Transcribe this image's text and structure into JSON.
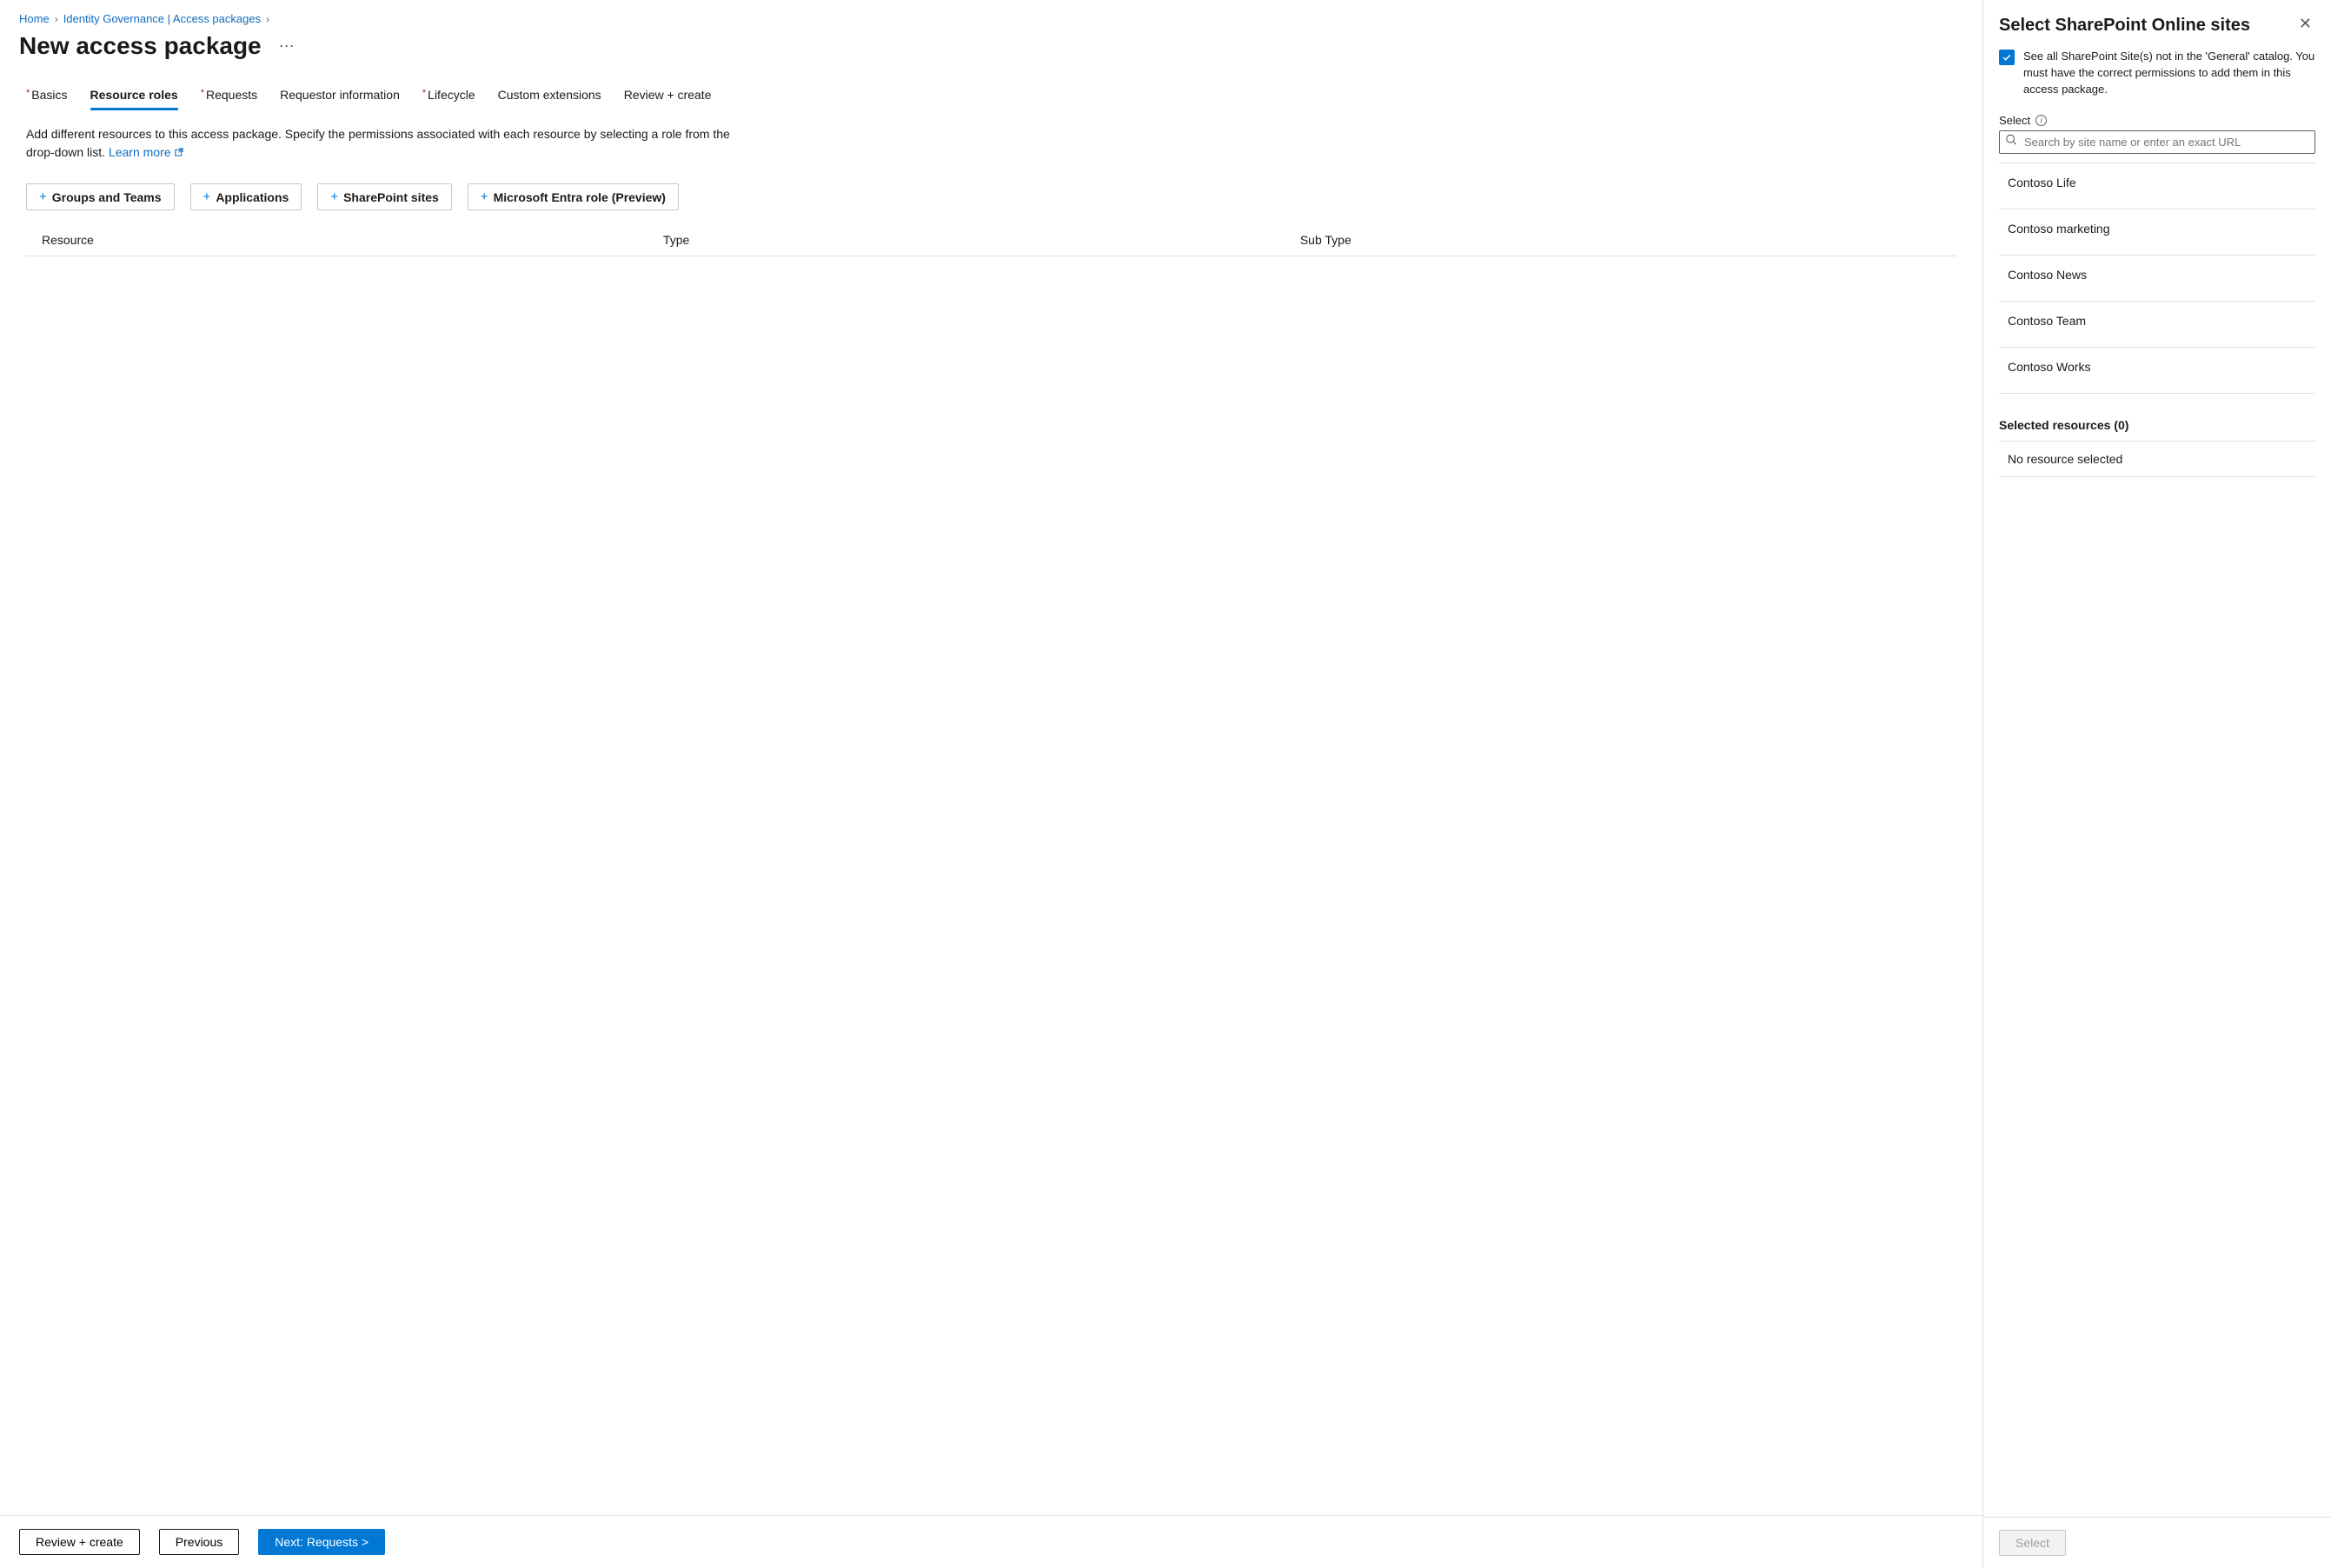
{
  "breadcrumb": {
    "home": "Home",
    "mid": "Identity Governance | Access packages",
    "current": ""
  },
  "page": {
    "title": "New access package"
  },
  "tabs": [
    {
      "label": "Basics",
      "required": true,
      "active": false
    },
    {
      "label": "Resource roles",
      "required": false,
      "active": true
    },
    {
      "label": "Requests",
      "required": true,
      "active": false
    },
    {
      "label": "Requestor information",
      "required": false,
      "active": false
    },
    {
      "label": "Lifecycle",
      "required": true,
      "active": false
    },
    {
      "label": "Custom extensions",
      "required": false,
      "active": false
    },
    {
      "label": "Review + create",
      "required": false,
      "active": false
    }
  ],
  "description": {
    "text": "Add different resources to this access package. Specify the permissions associated with each resource by selecting a role from the drop-down list. ",
    "link": "Learn more"
  },
  "resource_buttons": [
    {
      "label": "Groups and Teams"
    },
    {
      "label": "Applications"
    },
    {
      "label": "SharePoint sites"
    },
    {
      "label": "Microsoft Entra role (Preview)"
    }
  ],
  "table_headers": {
    "resource": "Resource",
    "type": "Type",
    "sub": "Sub Type"
  },
  "footer": {
    "review": "Review + create",
    "previous": "Previous",
    "next": "Next: Requests >"
  },
  "panel": {
    "title": "Select SharePoint Online sites",
    "checkbox_label": "See all SharePoint Site(s) not in the 'General' catalog. You must have the correct permissions to add them in this access package.",
    "select_label": "Select",
    "search_placeholder": "Search by site name or enter an exact URL",
    "sites": [
      "Contoso Life",
      "Contoso marketing",
      "Contoso News",
      "Contoso Team",
      "Contoso Works"
    ],
    "selected_header": "Selected resources (0)",
    "selected_empty": "No resource selected",
    "button": "Select"
  }
}
